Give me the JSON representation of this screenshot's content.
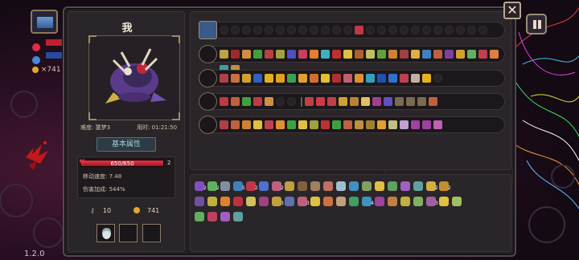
{
  "hud": {
    "gold": "×741",
    "heart_color": "#e03040",
    "mana_color": "#4a88e0",
    "version": "1.2.0"
  },
  "character": {
    "name": "我",
    "difficulty": "难度: 噩梦3",
    "time": "用时: 01:21:50",
    "attributes_header": "基本属性",
    "hp_text": "650/650",
    "hp_fraction": 1.0,
    "hp_count": "2",
    "move_speed": "移动速度: 7.48",
    "damage_bonus": "伤害加成: 544%",
    "keys": "10",
    "coins": "741",
    "slots": [
      {
        "icon": "potion-icon",
        "filled": true
      },
      {
        "icon": "empty-slot",
        "filled": false
      },
      {
        "icon": "empty-slot",
        "filled": false
      }
    ]
  },
  "weapons": [
    {
      "icon": "chest-icon",
      "gems": [
        "e",
        "e",
        "e",
        "e",
        "e",
        "e",
        "e",
        "e",
        "e",
        "e",
        "e",
        "e",
        "#c03848",
        "e",
        "e",
        "e",
        "e",
        "e",
        "e",
        "e",
        "e",
        "e",
        "e",
        "e"
      ]
    },
    {
      "icon": "staff-icon",
      "gems": [
        "#c0a040",
        "#a02830",
        "#d09040",
        "#40a040",
        "#b84040",
        "#a0a040",
        "#5050c0",
        "#c84060",
        "#e08030",
        "#40b0c0",
        "#c03030",
        "#e0c040",
        "#b06030",
        "#c0c060",
        "#60a040",
        "#d08030",
        "#a04040",
        "#e0b040",
        "#4080c0",
        "#c06040",
        "#8040a0",
        "#d0a030",
        "#60b060",
        "#c04050",
        "#e08040",
        "#40a0a0",
        "#c09040"
      ]
    },
    {
      "icon": "wand-icon",
      "gems": [
        "#b04048",
        "#c87040",
        "#d0a030",
        "#3060c0",
        "#e0b020",
        "#e0a020",
        "#40a050",
        "#e0a030",
        "#d07030",
        "#e0c030",
        "#b03030",
        "#c06070",
        "#e09030",
        "#30a0c0",
        "#2050b0",
        "#3070d0",
        "#c04050",
        "#c0b0a0",
        "#e8b020",
        "e"
      ]
    },
    {
      "icon": "orb-staff-icon",
      "gems": [
        "#c03840",
        "#c06040",
        "#40a040",
        "#c03848",
        "#d09040",
        "e",
        "e",
        "sep",
        "#c04048",
        "#d03848",
        "#c04048",
        "#d0a030",
        "#c08030",
        "#e0c060",
        "#a04090",
        "#6050c0",
        "#7a6a50",
        "#7a6a50",
        "#7a6a50",
        "#c06040"
      ]
    },
    {
      "icon": "branch-icon",
      "gems": [
        "#b04048",
        "#c06040",
        "#d08030",
        "#e0c040",
        "#c04050",
        "#e09030",
        "#40a040",
        "#e0c040",
        "#a0a040",
        "#c03030",
        "#40a040",
        "#c06040",
        "#c09040",
        "#a08030",
        "#e0a030",
        "#c0c080",
        "#c0a0d0",
        "#a040a0",
        "#a040a0",
        "#c060b0"
      ]
    }
  ],
  "items": [
    [
      {
        "c": "#8050c0",
        "n": "2"
      },
      {
        "c": "#60b060",
        "n": "2"
      },
      {
        "c": "#8090a0",
        "n": ""
      },
      {
        "c": "#4080c0",
        "n": "5"
      },
      {
        "c": "#c03848",
        "n": "2"
      },
      {
        "c": "#5070d0",
        "n": ""
      },
      {
        "c": "#c06080",
        "n": "2"
      },
      {
        "c": "#c0a040",
        "n": ""
      },
      {
        "c": "#806040",
        "n": ""
      },
      {
        "c": "#a08060",
        "n": ""
      },
      {
        "c": "#c07060",
        "n": ""
      },
      {
        "c": "#a0c0d0",
        "n": ""
      },
      {
        "c": "#4090c0",
        "n": ""
      },
      {
        "c": "#80a060",
        "n": ""
      },
      {
        "c": "#e0c040",
        "n": ""
      },
      {
        "c": "#60a060",
        "n": ""
      },
      {
        "c": "#a060c0",
        "n": ""
      },
      {
        "c": "#60a0a0",
        "n": ""
      },
      {
        "c": "#d0b040",
        "n": "2"
      },
      {
        "c": "#c09030",
        "n": "2"
      }
    ],
    [
      {
        "c": "#7050a0",
        "n": ""
      },
      {
        "c": "#c0b040",
        "n": ""
      },
      {
        "c": "#e08030",
        "n": ""
      },
      {
        "c": "#c03040",
        "n": ""
      },
      {
        "c": "#d0c060",
        "n": ""
      },
      {
        "c": "#a04080",
        "n": ""
      },
      {
        "c": "#c0a040",
        "n": "3"
      },
      {
        "c": "#6070b0",
        "n": ""
      },
      {
        "c": "#c06080",
        "n": "3"
      },
      {
        "c": "#e0c040",
        "n": ""
      },
      {
        "c": "#d07040",
        "n": ""
      },
      {
        "c": "#c0a080",
        "n": ""
      },
      {
        "c": "#40a060",
        "n": ""
      },
      {
        "c": "#4090c0",
        "n": "4"
      },
      {
        "c": "#a040a0",
        "n": ""
      },
      {
        "c": "#c08040",
        "n": ""
      },
      {
        "c": "#c0b040",
        "n": ""
      },
      {
        "c": "#80b060",
        "n": ""
      },
      {
        "c": "#a060a0",
        "n": "3"
      },
      {
        "c": "#e0c040",
        "n": ""
      },
      {
        "c": "#a0c060",
        "n": ""
      }
    ],
    [
      {
        "c": "#60b060",
        "n": ""
      },
      {
        "c": "#c04060",
        "n": ""
      },
      {
        "c": "#a060c0",
        "n": ""
      },
      {
        "c": "#60a0a0",
        "n": ""
      }
    ]
  ]
}
